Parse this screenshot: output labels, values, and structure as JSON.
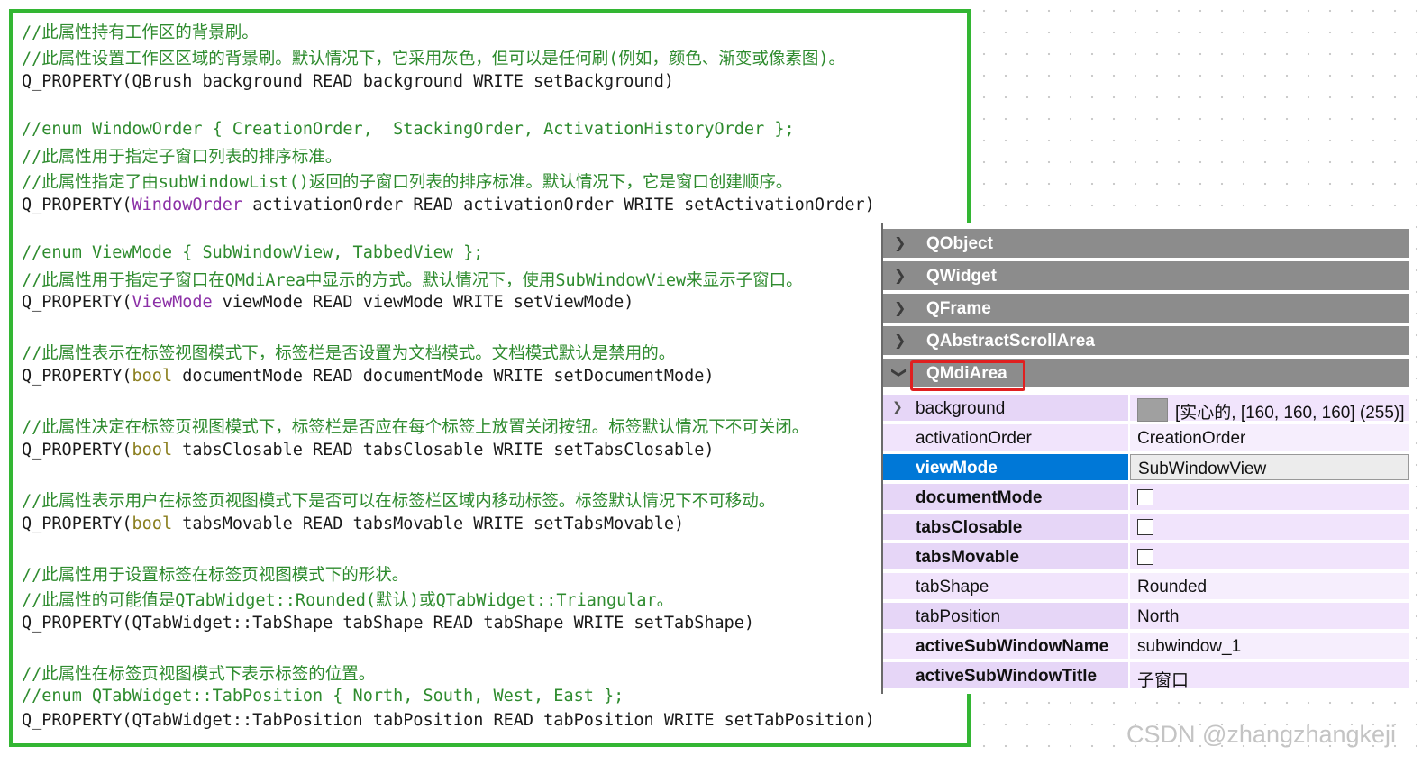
{
  "code": {
    "lines": [
      {
        "type": "comment",
        "text": "//此属性持有工作区的背景刷。"
      },
      {
        "type": "comment",
        "text": "//此属性设置工作区区域的背景刷。默认情况下，它采用灰色，但可以是任何刷(例如，颜色、渐变或像素图)。"
      },
      {
        "type": "code",
        "pre": "Q_PROPERTY(QBrush background READ background WRITE setBackground)"
      },
      {
        "type": "comment",
        "text": "//enum WindowOrder { CreationOrder,  StackingOrder, ActivationHistoryOrder };"
      },
      {
        "type": "comment",
        "text": "//此属性用于指定子窗口列表的排序标准。"
      },
      {
        "type": "comment",
        "text": "//此属性指定了由subWindowList()返回的子窗口列表的排序标准。默认情况下，它是窗口创建顺序。"
      },
      {
        "type": "code",
        "pre": "Q_PROPERTY(",
        "typed": "WindowOrder",
        "post": " activationOrder READ activationOrder WRITE setActivationOrder)"
      },
      {
        "type": "comment",
        "text": "//enum ViewMode { SubWindowView, TabbedView };"
      },
      {
        "type": "comment",
        "text": "//此属性用于指定子窗口在QMdiArea中显示的方式。默认情况下，使用SubWindowView来显示子窗口。"
      },
      {
        "type": "code",
        "pre": "Q_PROPERTY(",
        "typed": "ViewMode",
        "post": " viewMode READ viewMode WRITE setViewMode)"
      },
      {
        "type": "comment",
        "text": "//此属性表示在标签视图模式下，标签栏是否设置为文档模式。文档模式默认是禁用的。"
      },
      {
        "type": "code",
        "pre": "Q_PROPERTY(",
        "kw": "bool",
        "post": " documentMode READ documentMode WRITE setDocumentMode)"
      },
      {
        "type": "comment",
        "text": "//此属性决定在标签页视图模式下，标签栏是否应在每个标签上放置关闭按钮。标签默认情况下不可关闭。"
      },
      {
        "type": "code",
        "pre": "Q_PROPERTY(",
        "kw": "bool",
        "post": " tabsClosable READ tabsClosable WRITE setTabsClosable)"
      },
      {
        "type": "comment",
        "text": "//此属性表示用户在标签页视图模式下是否可以在标签栏区域内移动标签。标签默认情况下不可移动。"
      },
      {
        "type": "code",
        "pre": "Q_PROPERTY(",
        "kw": "bool",
        "post": " tabsMovable READ tabsMovable WRITE setTabsMovable)"
      },
      {
        "type": "comment",
        "text": "//此属性用于设置标签在标签页视图模式下的形状。"
      },
      {
        "type": "comment",
        "text": "//此属性的可能值是QTabWidget::Rounded(默认)或QTabWidget::Triangular。"
      },
      {
        "type": "code",
        "pre": "Q_PROPERTY(QTabWidget::TabShape tabShape READ tabShape WRITE setTabShape)"
      },
      {
        "type": "comment",
        "text": "//此属性在标签页视图模式下表示标签的位置。"
      },
      {
        "type": "comment",
        "text": "//enum QTabWidget::TabPosition { North, South, West, East };"
      },
      {
        "type": "code",
        "pre": "Q_PROPERTY(QTabWidget::TabPosition tabPosition READ tabPosition WRITE setTabPosition)"
      }
    ]
  },
  "property_editor": {
    "groups": [
      {
        "label": "QObject",
        "expanded": false
      },
      {
        "label": "QWidget",
        "expanded": false
      },
      {
        "label": "QFrame",
        "expanded": false
      },
      {
        "label": "QAbstractScrollArea",
        "expanded": false
      },
      {
        "label": "QMdiArea",
        "expanded": true
      }
    ],
    "properties": [
      {
        "name": "background",
        "value": "[实心的, [160, 160, 160] (255)]",
        "swatch_color": "#a0a0a0"
      },
      {
        "name": "activationOrder",
        "value": "CreationOrder"
      },
      {
        "name": "viewMode",
        "value": "SubWindowView"
      },
      {
        "name": "documentMode",
        "checked": false
      },
      {
        "name": "tabsClosable",
        "checked": false
      },
      {
        "name": "tabsMovable",
        "checked": false
      },
      {
        "name": "tabShape",
        "value": "Rounded"
      },
      {
        "name": "tabPosition",
        "value": "North"
      },
      {
        "name": "activeSubWindowName",
        "value": "subwindow_1"
      },
      {
        "name": "activeSubWindowTitle",
        "value": "子窗口"
      }
    ],
    "selected": "viewMode"
  },
  "watermark": "CSDN @zhangzhangkeji",
  "colors": {
    "frame_green": "#33b633",
    "comment_green": "#2e8b2e",
    "keyword_olive": "#8a7e1e",
    "type_purple": "#8b2fa6",
    "group_gray": "#8c8c8c",
    "highlight_red": "#e02020",
    "selection_blue": "#0078d7",
    "row_lavender": "#e6d6f7"
  }
}
